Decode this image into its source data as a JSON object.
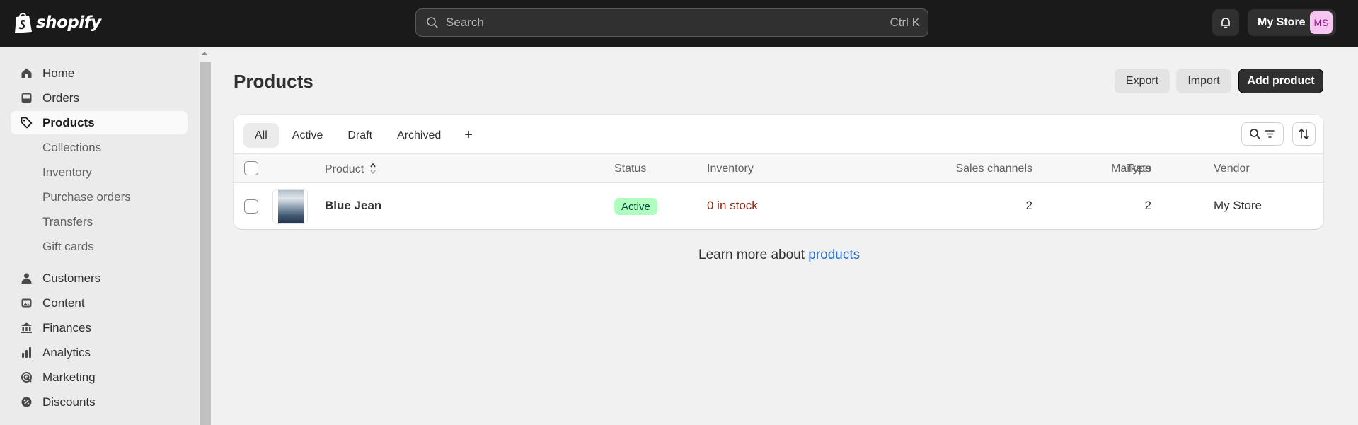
{
  "topbar": {
    "brand": "shopify",
    "search_placeholder": "Search",
    "search_shortcut": "Ctrl K",
    "store_name": "My Store",
    "avatar_initials": "MS"
  },
  "sidebar": {
    "items": [
      {
        "label": "Home",
        "icon": "home-icon"
      },
      {
        "label": "Orders",
        "icon": "orders-inbox-icon"
      },
      {
        "label": "Products",
        "icon": "tag-icon",
        "active": true
      },
      {
        "label": "Collections"
      },
      {
        "label": "Inventory"
      },
      {
        "label": "Purchase orders"
      },
      {
        "label": "Transfers"
      },
      {
        "label": "Gift cards"
      },
      {
        "label": "Customers",
        "icon": "person-icon"
      },
      {
        "label": "Content",
        "icon": "image-icon"
      },
      {
        "label": "Finances",
        "icon": "bank-icon"
      },
      {
        "label": "Analytics",
        "icon": "bar-chart-icon"
      },
      {
        "label": "Marketing",
        "icon": "target-icon"
      },
      {
        "label": "Discounts",
        "icon": "discount-gear-icon"
      }
    ]
  },
  "page": {
    "title": "Products",
    "export_label": "Export",
    "import_label": "Import",
    "add_label": "Add product"
  },
  "tabs": [
    "All",
    "Active",
    "Draft",
    "Archived",
    "+"
  ],
  "table": {
    "headers": [
      "Product",
      "Status",
      "Inventory",
      "Sales channels",
      "Markets",
      "Type",
      "Vendor"
    ],
    "rows": [
      {
        "product": "Blue Jean",
        "status": "Active",
        "inventory": "0 in stock",
        "sales_channels": "2",
        "markets": "2",
        "type": "",
        "vendor": "My Store"
      }
    ]
  },
  "learn": {
    "prefix": "Learn more about ",
    "link": "products"
  },
  "colors": {
    "topbar": "#1a1a1a",
    "active_badge_bg": "#affebf",
    "out_of_stock_text": "#8e1f0b",
    "link": "#2c6ecb"
  }
}
